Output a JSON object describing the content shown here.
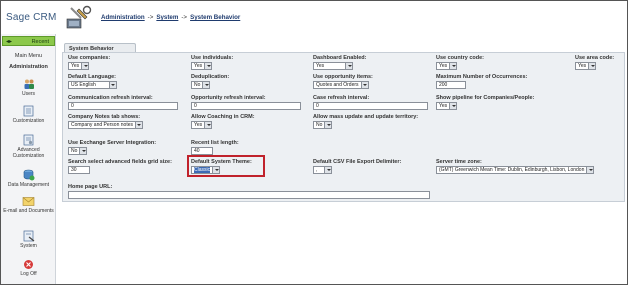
{
  "app": {
    "brand": "Sage CRM"
  },
  "breadcrumb": {
    "admin": "Administration",
    "system": "System",
    "behavior": "System Behavior",
    "sep": "->"
  },
  "sidebar": {
    "recent": "Recent",
    "main_menu": "Main Menu",
    "section": "Administration",
    "items": [
      "Users",
      "Customization",
      "Advanced Customization",
      "Data Management",
      "E-mail and Documents",
      "System",
      "Log Off"
    ]
  },
  "tab": {
    "label": "System Behavior"
  },
  "form": {
    "use_companies": {
      "label": "Use companies:",
      "value": "Yes"
    },
    "use_individuals": {
      "label": "Use individuals:",
      "value": "Yes"
    },
    "dashboard_enabled": {
      "label": "Dashboard Enabled:",
      "value": "Yes"
    },
    "use_country_code": {
      "label": "Use country code:",
      "value": "Yes"
    },
    "use_area_code": {
      "label": "Use area code:",
      "value": "Yes"
    },
    "default_language": {
      "label": "Default Language:",
      "value": "US English"
    },
    "deduplication": {
      "label": "Deduplication:",
      "value": "No"
    },
    "use_opportunity_items": {
      "label": "Use opportunity items:",
      "value": "Quotes and Orders"
    },
    "max_occurrences": {
      "label": "Maximum Number of Occurrences:",
      "value": "200"
    },
    "comm_refresh": {
      "label": "Communication refresh interval:",
      "value": "0"
    },
    "opp_refresh": {
      "label": "Opportunity refresh interval:",
      "value": "0"
    },
    "case_refresh": {
      "label": "Case refresh interval:",
      "value": "0"
    },
    "show_pipeline": {
      "label": "Show pipeline for Companies/People:",
      "value": "Yes"
    },
    "company_notes_tab": {
      "label": "Company Notes tab shows:",
      "value": "Company and Person notes"
    },
    "allow_coaching": {
      "label": "Allow Coaching in CRM:",
      "value": "Yes"
    },
    "mass_update": {
      "label": "Allow mass update and update territory:",
      "value": "No"
    },
    "exchange_integration": {
      "label": "Use Exchange Server Integration:",
      "value": "No"
    },
    "recent_list_length": {
      "label": "Recent list length:",
      "value": "40"
    },
    "search_fields_size": {
      "label": "Search select advanced fields grid size:",
      "value": "30"
    },
    "default_theme": {
      "label": "Default System Theme:",
      "value": "Classic"
    },
    "csv_delimiter": {
      "label": "Default CSV File Export Delimiter:",
      "value": ","
    },
    "server_timezone": {
      "label": "Server time zone:",
      "value": "(GMT) Greenwich Mean Time: Dublin, Edinburgh, Lisbon, London"
    },
    "home_page_url": {
      "label": "Home page URL:",
      "value": ""
    }
  },
  "colors": {
    "highlight": "#c0222b",
    "recent": "#8cc84b",
    "link": "#1f3b6e"
  }
}
